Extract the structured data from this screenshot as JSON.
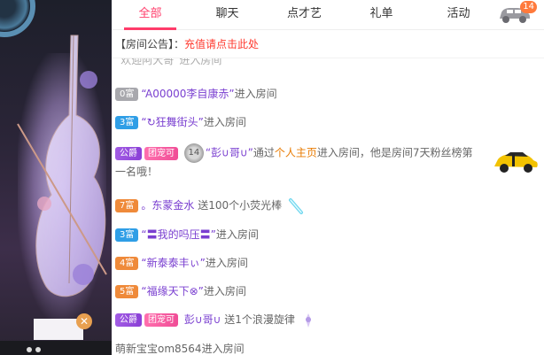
{
  "tabs": [
    {
      "label": "全部",
      "active": true
    },
    {
      "label": "聊天",
      "active": false
    },
    {
      "label": "点才艺",
      "active": false
    },
    {
      "label": "礼单",
      "active": false
    },
    {
      "label": "活动",
      "active": false
    }
  ],
  "car_badge_count": "14",
  "notice": {
    "prefix": "【房间公告】：",
    "link": "充值请点击此处"
  },
  "messages": {
    "m0": {
      "text": "“欢迎阿大哥”进入房间"
    },
    "m1": {
      "badge": "0富",
      "name": "“A00000李自康赤”",
      "action": "进入房间"
    },
    "m2": {
      "badge": "3富",
      "name": "“↻狂舞街头”",
      "action": "进入房间"
    },
    "m3": {
      "badge1": "公爵",
      "badge2": "团宠可",
      "vip": "14",
      "name": "“彭∪哥∪”",
      "pre": "通过",
      "link": "个人主页",
      "action": "进入房间，他是房间7天粉丝榜第一名哦！"
    },
    "m4": {
      "badge": "7富",
      "name": "。东蒙金水",
      "action": "送100个小荧光棒"
    },
    "m5": {
      "badge": "3富",
      "name": "“〓我的吗压〓”",
      "action": "进入房间"
    },
    "m6": {
      "badge": "4富",
      "name": "“新泰泰丰ぃ”",
      "action": "进入房间"
    },
    "m7": {
      "badge": "5富",
      "name": "“福缘天下⊗”",
      "action": "进入房间"
    },
    "m8": {
      "badge1": "公爵",
      "badge2": "团宠可",
      "name": "彭∪哥∪",
      "action": "送1个浪漫旋律"
    },
    "m9": {
      "text": "萌新宝宝om8564进入房间"
    }
  },
  "colors": {
    "accent": "#ff3c6a",
    "notice_link": "#ff3b30",
    "badge_blue": "#2f9ee6",
    "badge_orange": "#ef8a3a",
    "badge_purple": "#a25ce4",
    "badge_pink": "#f04d96",
    "name_purple": "#7a3fd0",
    "highlight": "#e87a00"
  },
  "icons": {
    "car": "car-icon",
    "vip": "vip-level-icon",
    "lightstick": "glow-stick-icon",
    "melody": "melody-gift-icon"
  }
}
